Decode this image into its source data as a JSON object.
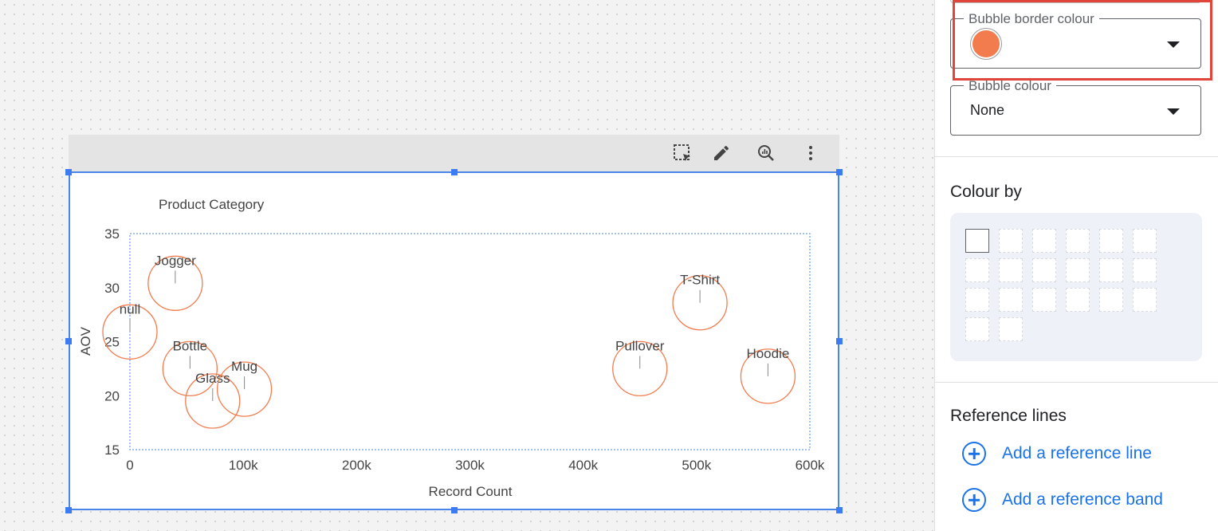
{
  "panel": {
    "bubble_border": {
      "label": "Bubble border colour",
      "color": "#f27c4e"
    },
    "bubble_colour": {
      "label": "Bubble colour",
      "value": "None"
    },
    "colour_by": {
      "title": "Colour by"
    },
    "reference_lines": {
      "title": "Reference lines",
      "add_line": "Add a reference line",
      "add_band": "Add a reference band"
    }
  },
  "chart_data": {
    "type": "scatter",
    "title": "Product Category",
    "xlabel": "Record Count",
    "ylabel": "AOV",
    "xlim": [
      0,
      600000
    ],
    "ylim": [
      15,
      35
    ],
    "x_ticks": [
      "0",
      "100k",
      "200k",
      "300k",
      "400k",
      "500k",
      "600k"
    ],
    "y_ticks": [
      "15",
      "20",
      "25",
      "30",
      "35"
    ],
    "bubble_border_color": "#f27c4e",
    "points": [
      {
        "label": "Jogger",
        "x": 40000,
        "y": 30.4
      },
      {
        "label": "null",
        "x": 0,
        "y": 25.9
      },
      {
        "label": "Bottle",
        "x": 53000,
        "y": 22.5
      },
      {
        "label": "Glass",
        "x": 73000,
        "y": 19.5
      },
      {
        "label": "Mug",
        "x": 101000,
        "y": 20.6
      },
      {
        "label": "T-Shirt",
        "x": 503000,
        "y": 28.6
      },
      {
        "label": "Pullover",
        "x": 450000,
        "y": 22.5
      },
      {
        "label": "Hoodie",
        "x": 563000,
        "y": 21.8
      }
    ]
  }
}
